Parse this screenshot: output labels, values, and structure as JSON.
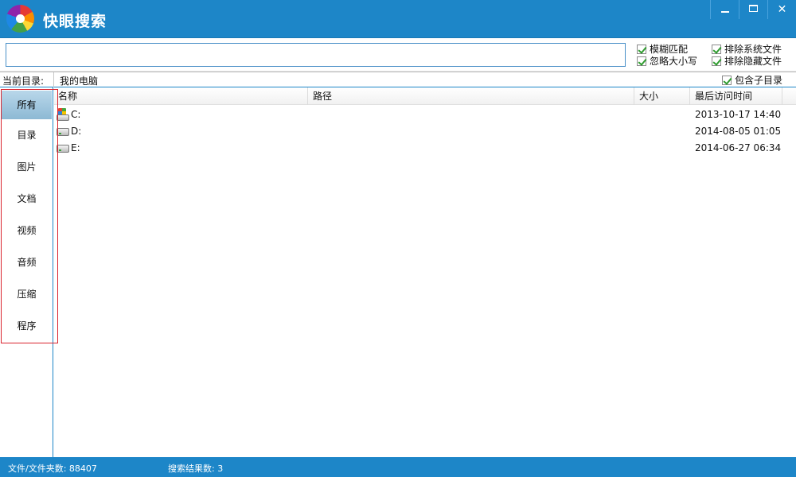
{
  "window": {
    "title": "快眼搜索",
    "minimize_label": "_",
    "maximize_label": "□",
    "close_label": "✕"
  },
  "search": {
    "value": "",
    "placeholder": ""
  },
  "options": {
    "fuzzy_match": {
      "label": "模糊匹配",
      "checked": true
    },
    "ignore_case": {
      "label": "忽略大小写",
      "checked": true
    },
    "exclude_system": {
      "label": "排除系统文件",
      "checked": true
    },
    "exclude_hidden": {
      "label": "排除隐藏文件",
      "checked": true
    }
  },
  "current_dir": {
    "label": "当前目录:",
    "value": "我的电脑",
    "include_subdirs": {
      "label": "包含子目录",
      "checked": true
    }
  },
  "sidebar": {
    "items": [
      {
        "label": "所有",
        "active": true
      },
      {
        "label": "目录",
        "active": false
      },
      {
        "label": "图片",
        "active": false
      },
      {
        "label": "文档",
        "active": false
      },
      {
        "label": "视频",
        "active": false
      },
      {
        "label": "音频",
        "active": false
      },
      {
        "label": "压缩",
        "active": false
      },
      {
        "label": "程序",
        "active": false
      }
    ]
  },
  "table": {
    "columns": [
      "名称",
      "路径",
      "大小",
      "最后访问时间"
    ],
    "rows": [
      {
        "name": "C:",
        "path": "",
        "size": "",
        "accessed": "2013-10-17 14:40",
        "icon": "system-drive-icon"
      },
      {
        "name": "D:",
        "path": "",
        "size": "",
        "accessed": "2014-08-05 01:05",
        "icon": "drive-icon"
      },
      {
        "name": "E:",
        "path": "",
        "size": "",
        "accessed": "2014-06-27 06:34",
        "icon": "drive-icon"
      }
    ]
  },
  "status": {
    "file_count": "文件/文件夹数: 88407",
    "result_count": "搜索结果数: 3"
  },
  "colors": {
    "accent": "#1d86c8",
    "highlight_border": "#d9232e",
    "check": "#2f9c2f"
  }
}
